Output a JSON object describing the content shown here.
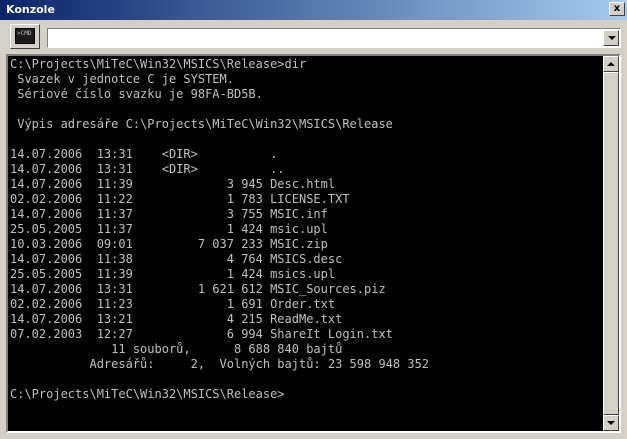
{
  "window": {
    "title": "Konzole",
    "close_glyph": "x"
  },
  "toolbar": {
    "cmd_icon_text": ">CMD",
    "command_value": ""
  },
  "console": {
    "lines": [
      "C:\\Projects\\MiTeC\\Win32\\MSICS\\Release>dir",
      " Svazek v jednotce C je SYSTEM.",
      " Sériové číslo svazku je 98FA-BD5B.",
      "",
      " Výpis adresáře C:\\Projects\\MiTeC\\Win32\\MSICS\\Release",
      "",
      "14.07.2006  13:31    <DIR>          .",
      "14.07.2006  13:31    <DIR>          ..",
      "14.07.2006  11:39             3 945 Desc.html",
      "02.02.2006  11:22             1 783 LICENSE.TXT",
      "14.07.2006  11:37             3 755 MSIC.inf",
      "25.05.2005  11:37             1 424 msic.upl",
      "10.03.2006  09:01         7 037 233 MSIC.zip",
      "14.07.2006  11:38             4 764 MSICS.desc",
      "25.05.2005  11:39             1 424 msics.upl",
      "14.07.2006  13:31         1 621 612 MSIC_Sources.piz",
      "02.02.2006  11:23             1 691 Order.txt",
      "14.07.2006  13:21             4 215 ReadMe.txt",
      "07.02.2003  12:27             6 994 ShareIt Login.txt",
      "              11 souborů,      8 688 840 bajtů",
      "           Adresářů:     2,  Volných bajtů: 23 598 948 352",
      "",
      "C:\\Projects\\MiTeC\\Win32\\MSICS\\Release>"
    ]
  }
}
